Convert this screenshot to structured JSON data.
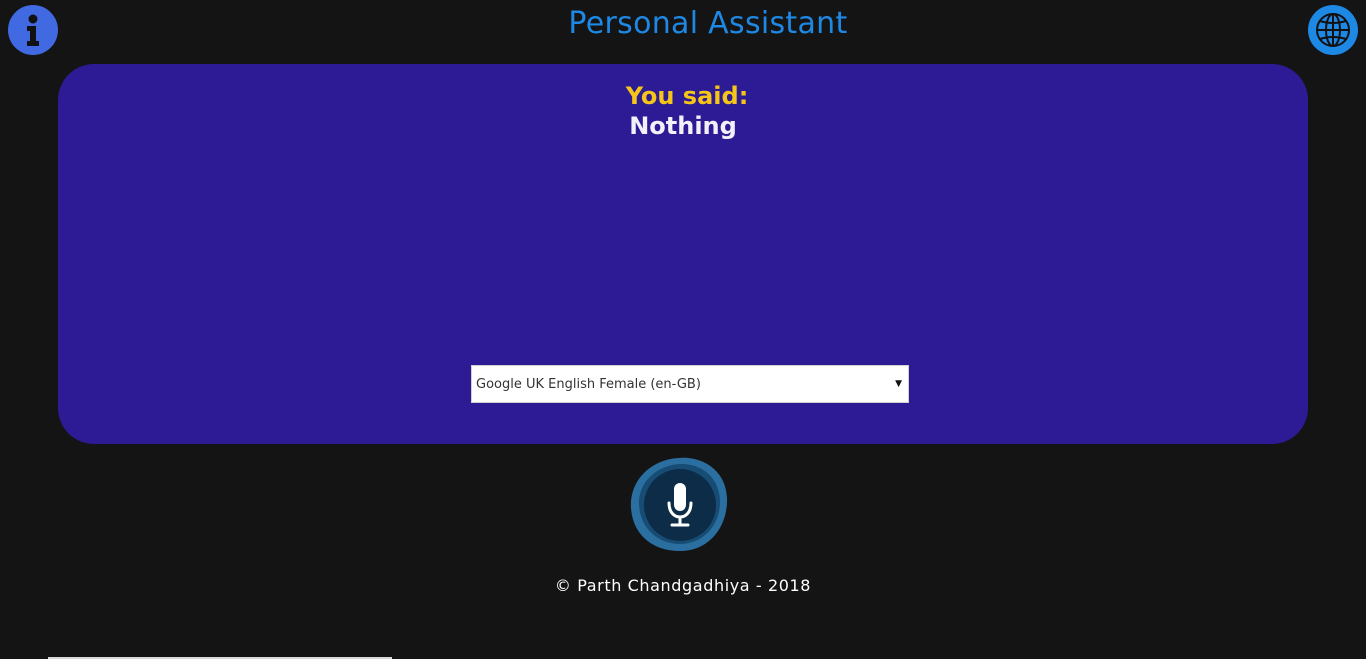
{
  "header": {
    "title": "Personal Assistant",
    "info_icon": "info-icon",
    "language_icon": "globe-icon"
  },
  "panel": {
    "you_said_label": "You said:",
    "you_said_text": "Nothing",
    "voice_select": {
      "selected": "Google UK English Female (en-GB)"
    }
  },
  "mic": {
    "icon": "microphone-icon"
  },
  "footer": {
    "text": "© Parth Chandgadhiya - 2018"
  },
  "colors": {
    "background": "#141414",
    "title": "#1e88e5",
    "panel": "#2d1b96",
    "label": "#f5c518",
    "info_button": "#4169e1",
    "globe_button": "#1e88e5"
  }
}
